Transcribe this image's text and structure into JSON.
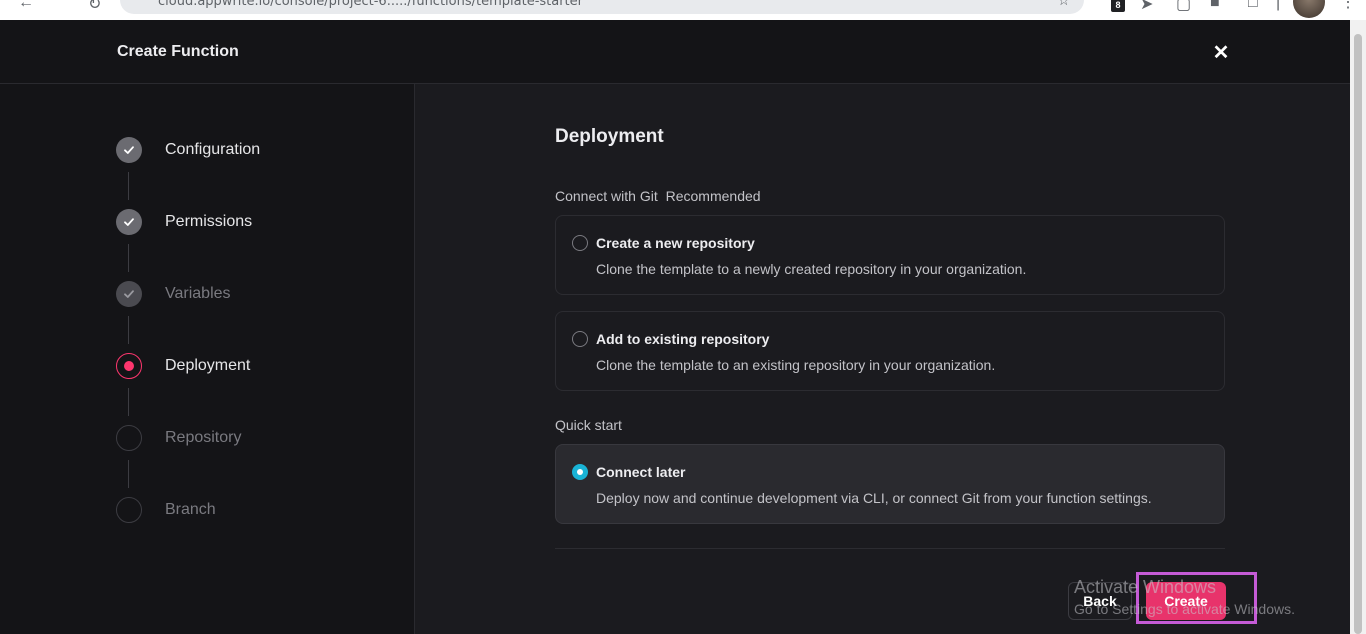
{
  "browser": {
    "url": "cloud.appwrite.io/console/project-6...../functions/template-starter",
    "extension_badge": "8"
  },
  "modal": {
    "title": "Create Function",
    "close_icon": "close-icon"
  },
  "steps": [
    {
      "label": "Configuration",
      "state": "done"
    },
    {
      "label": "Permissions",
      "state": "done"
    },
    {
      "label": "Variables",
      "state": "done-dim"
    },
    {
      "label": "Deployment",
      "state": "active"
    },
    {
      "label": "Repository",
      "state": "pending"
    },
    {
      "label": "Branch",
      "state": "pending"
    }
  ],
  "content": {
    "section_title": "Deployment",
    "git_group": {
      "label": "Connect with Git",
      "tag": "Recommended"
    },
    "options": [
      {
        "title": "Create a new repository",
        "description": "Clone the template to a newly created repository in your organization.",
        "selected": false
      },
      {
        "title": "Add to existing repository",
        "description": "Clone the template to an existing repository in your organization.",
        "selected": false
      }
    ],
    "quick_start": {
      "label": "Quick start",
      "option": {
        "title": "Connect later",
        "description": "Deploy now and continue development via CLI, or connect Git from your function settings.",
        "selected": true
      }
    }
  },
  "footer": {
    "back_label": "Back",
    "create_label": "Create"
  },
  "watermark": {
    "title": "Activate Windows",
    "subtitle": "Go to Settings to activate Windows."
  },
  "colors": {
    "accent": "#fd366e",
    "create_button": "#e8336b",
    "radio_selected": "#19b3d6",
    "highlight": "#c55bd6"
  }
}
